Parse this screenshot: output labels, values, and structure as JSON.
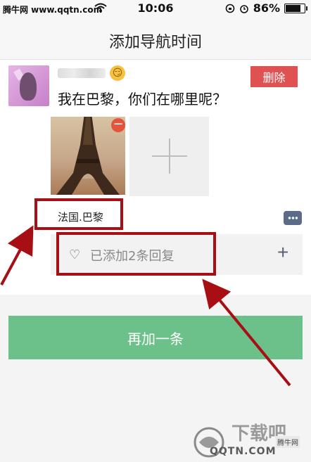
{
  "status_bar": {
    "watermark": "腾牛网 www.qqtn.com",
    "time": "10:06",
    "battery": "86%",
    "battery_level": 0.86
  },
  "nav": {
    "title": "添加导航时间"
  },
  "post": {
    "delete_label": "删除",
    "emoji": "😏",
    "text": "我在巴黎，你们在哪里呢？",
    "location": "法国.巴黎",
    "photo_remove_symbol": "−",
    "replies": "已添加2条回复",
    "add_reply_symbol": "+"
  },
  "actions": {
    "add_more_label": "再加一条"
  },
  "watermark": {
    "brand_label": "腾牛网",
    "site": "QQTN.COM"
  },
  "colors": {
    "accent_green": "#6cc18a",
    "delete_red": "#e05252",
    "annotation_red": "#a80f14"
  }
}
